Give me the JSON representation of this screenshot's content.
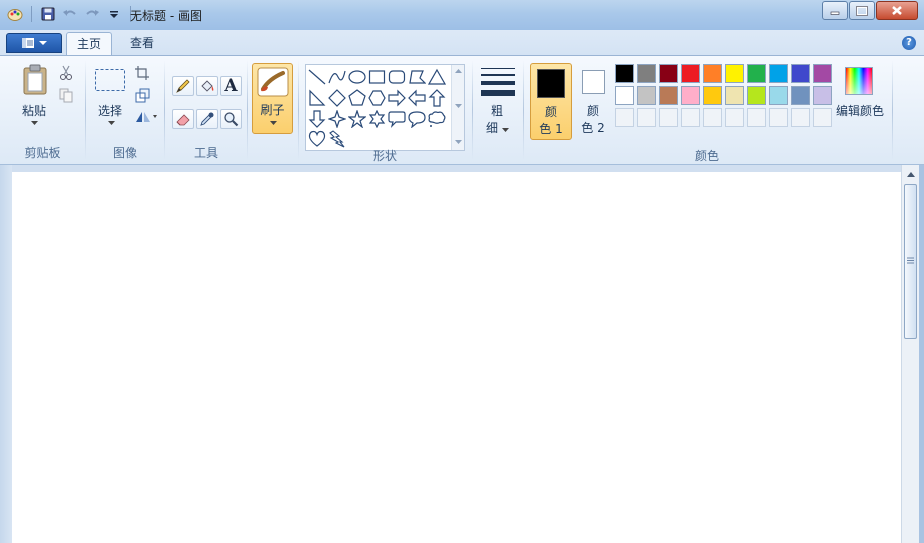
{
  "window": {
    "title": "无标题 - 画图"
  },
  "tabs": {
    "home": "主页",
    "view": "查看"
  },
  "help": "?",
  "clipboard": {
    "paste": "粘贴",
    "group": "剪贴板"
  },
  "image": {
    "select": "选择",
    "group": "图像"
  },
  "tools": {
    "group": "工具",
    "text_tool": "A"
  },
  "brushes": {
    "label": "刷子"
  },
  "shapes": {
    "group": "形状"
  },
  "size": {
    "line1": "粗",
    "line2": "细"
  },
  "colors": {
    "color1_line1": "颜",
    "color1_line2": "色 1",
    "color2_line1": "颜",
    "color2_line2": "色 2",
    "edit": "编辑颜色",
    "group": "颜色",
    "row1": [
      "#000000",
      "#7f7f7f",
      "#880015",
      "#ed1c24",
      "#ff7f27",
      "#fff200",
      "#22b14c",
      "#00a2e8",
      "#3f48cc",
      "#a349a4"
    ],
    "row2": [
      "#ffffff",
      "#c3c3c3",
      "#b97a57",
      "#ffaec9",
      "#ffc90e",
      "#efe4b0",
      "#b5e61d",
      "#99d9ea",
      "#7092be",
      "#c8bfe7"
    ]
  }
}
